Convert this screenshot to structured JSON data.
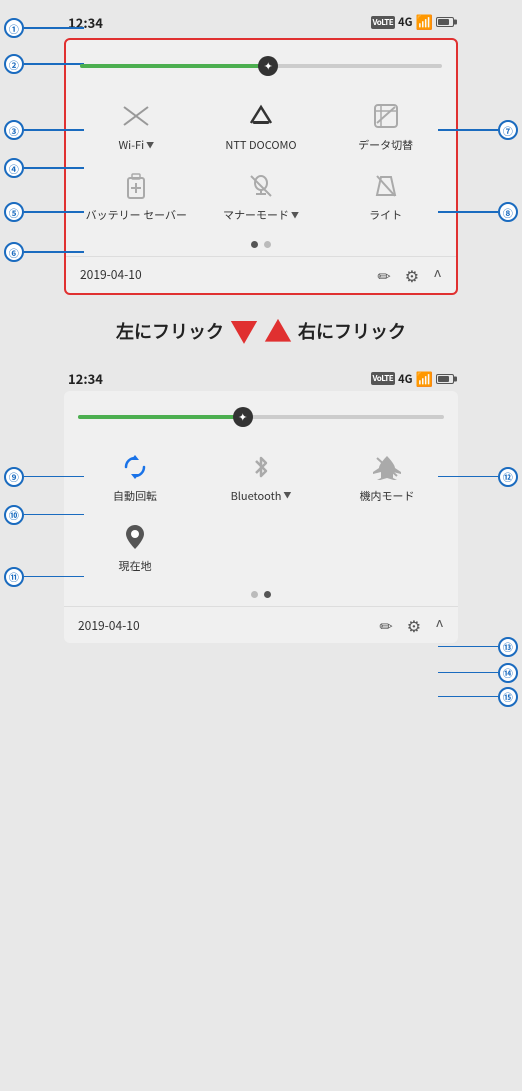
{
  "top_panel": {
    "status_bar": {
      "time": "12:34",
      "volte": "VoLTE",
      "network": "4G"
    },
    "brightness_slider": {
      "fill_percent": 52
    },
    "tiles": [
      {
        "id": "wifi",
        "label": "Wi-Fi",
        "has_dropdown": true,
        "state": "off"
      },
      {
        "id": "ntt",
        "label": "NTT DOCOMO",
        "has_dropdown": false,
        "state": "on"
      },
      {
        "id": "data",
        "label": "データ切替",
        "has_dropdown": false,
        "state": "off"
      },
      {
        "id": "battery_saver",
        "label": "バッテリー セーバー",
        "has_dropdown": false,
        "state": "off"
      },
      {
        "id": "manner",
        "label": "マナーモード",
        "has_dropdown": true,
        "state": "off"
      },
      {
        "id": "light",
        "label": "ライト",
        "has_dropdown": false,
        "state": "off"
      }
    ],
    "dots": [
      {
        "active": true
      },
      {
        "active": false
      }
    ],
    "footer": {
      "date": "2019-04-10",
      "edit_label": "✏",
      "settings_label": "⚙",
      "expand_label": "^"
    }
  },
  "middle": {
    "left_text": "左にフリック",
    "right_text": "右にフリック"
  },
  "bottom_panel": {
    "status_bar": {
      "time": "12:34",
      "volte": "VoLTE",
      "network": "4G"
    },
    "tiles": [
      {
        "id": "rotate",
        "label": "自動回転",
        "has_dropdown": false,
        "state": "on"
      },
      {
        "id": "bluetooth",
        "label": "Bluetooth",
        "has_dropdown": true,
        "state": "off"
      },
      {
        "id": "airplane",
        "label": "機内モード",
        "has_dropdown": false,
        "state": "off"
      },
      {
        "id": "location",
        "label": "現在地",
        "has_dropdown": false,
        "state": "on"
      }
    ],
    "dots": [
      {
        "active": false
      },
      {
        "active": true
      }
    ],
    "footer": {
      "date": "2019-04-10",
      "edit_label": "✏",
      "settings_label": "⚙",
      "expand_label": "^"
    }
  },
  "annotations": {
    "top": [
      "①",
      "②",
      "③",
      "④",
      "⑤",
      "⑥",
      "⑦",
      "⑧"
    ],
    "bottom": [
      "⑨",
      "⑩",
      "⑪",
      "⑫",
      "⑬",
      "⑭",
      "⑮"
    ]
  }
}
